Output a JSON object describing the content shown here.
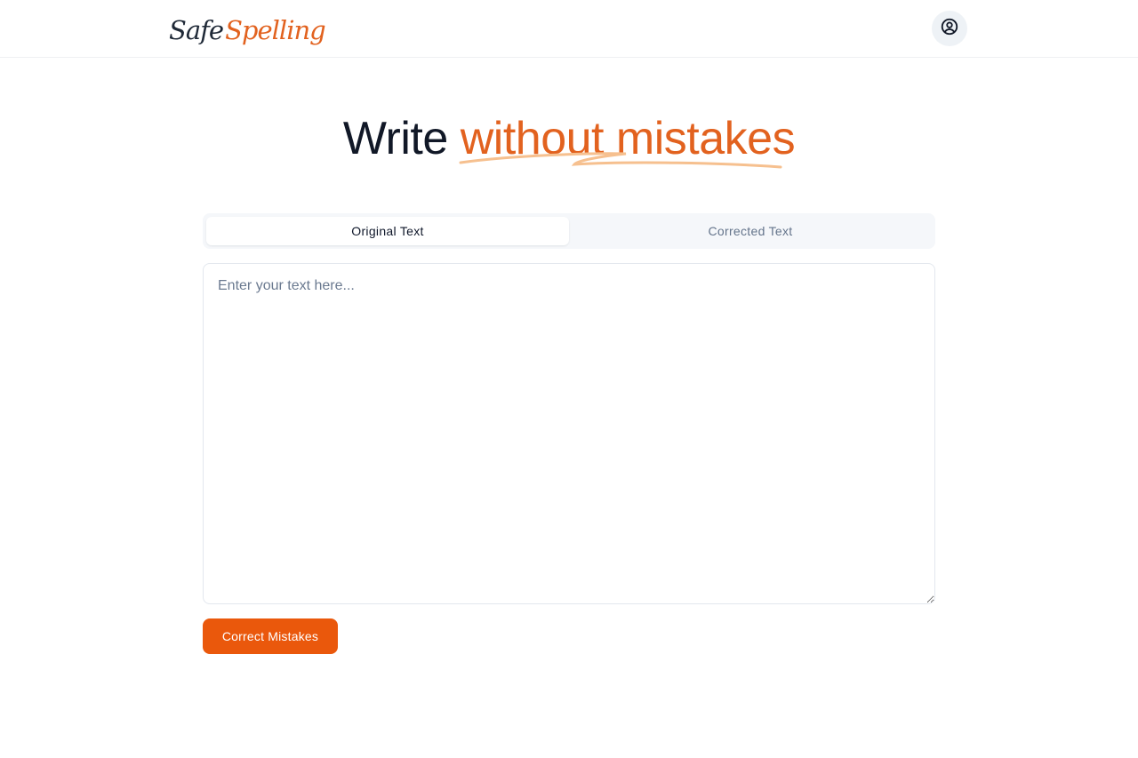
{
  "header": {
    "logo_part1": "Safe",
    "logo_part2": "Spelling",
    "account_icon": "user-circle-icon"
  },
  "hero": {
    "title_plain": "Write ",
    "title_highlight": "without mistakes"
  },
  "tabs": [
    {
      "label": "Original Text",
      "active": true
    },
    {
      "label": "Corrected Text",
      "active": false
    }
  ],
  "editor": {
    "value": "",
    "placeholder": "Enter your text here..."
  },
  "actions": {
    "correct_label": "Correct Mistakes"
  },
  "colors": {
    "accent": "#ea580c",
    "accent_text": "#e2621f",
    "swoosh": "#f6c08f"
  }
}
